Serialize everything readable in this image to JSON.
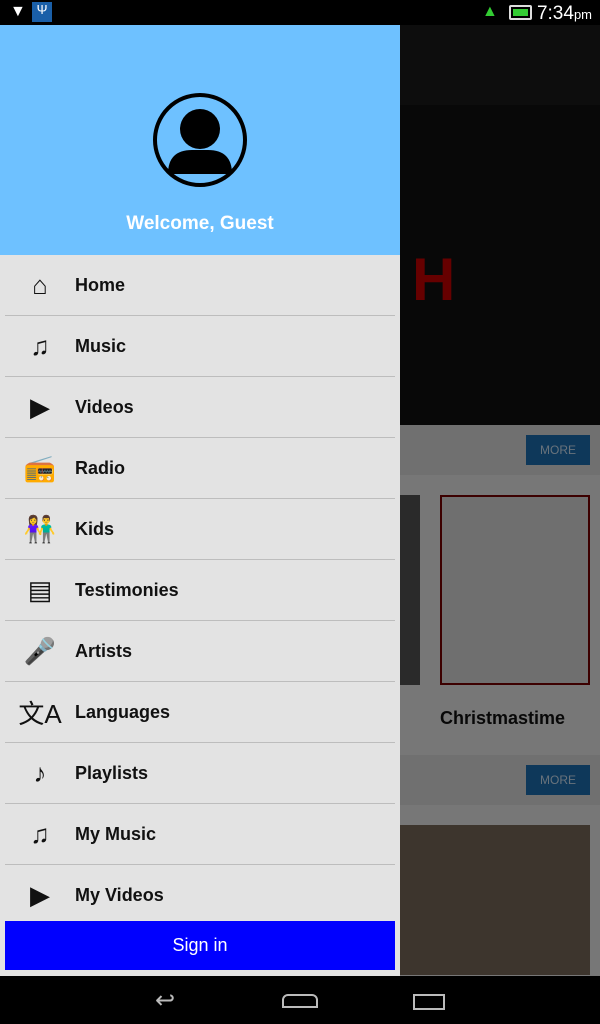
{
  "status_bar": {
    "time": "7:34",
    "ampm": "pm"
  },
  "drawer": {
    "welcome": "Welcome, Guest",
    "items": [
      {
        "label": "Home",
        "icon": "home-icon",
        "glyph": "⌂"
      },
      {
        "label": "Music",
        "icon": "music-note-icon",
        "glyph": "♫"
      },
      {
        "label": "Videos",
        "icon": "film-icon",
        "glyph": "▶"
      },
      {
        "label": "Radio",
        "icon": "radio-icon",
        "glyph": "📻"
      },
      {
        "label": "Kids",
        "icon": "kids-icon",
        "glyph": "👫"
      },
      {
        "label": "Testimonies",
        "icon": "document-icon",
        "glyph": "▤"
      },
      {
        "label": "Artists",
        "icon": "singer-icon",
        "glyph": "🎤"
      },
      {
        "label": "Languages",
        "icon": "translate-icon",
        "glyph": "文A"
      },
      {
        "label": "Playlists",
        "icon": "playlist-icon",
        "glyph": "♪"
      },
      {
        "label": "My Music",
        "icon": "music-note-icon",
        "glyph": "♫"
      },
      {
        "label": "My Videos",
        "icon": "film-icon",
        "glyph": "▶"
      }
    ],
    "sign_in": "Sign in"
  },
  "background": {
    "more_label": "MORE",
    "album_title": "Christmastime"
  }
}
